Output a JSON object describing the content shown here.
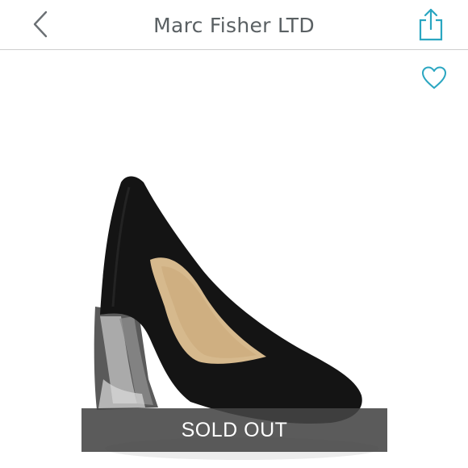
{
  "header": {
    "title": "Marc Fisher LTD",
    "back_icon": "chevron-left-icon",
    "share_icon": "share-icon"
  },
  "product": {
    "like_icon": "heart-outline-icon",
    "status_label": "SOLD OUT"
  },
  "colors": {
    "accent": "#2aa6c1",
    "title_text": "#5a6063",
    "banner_bg": "#444444"
  }
}
